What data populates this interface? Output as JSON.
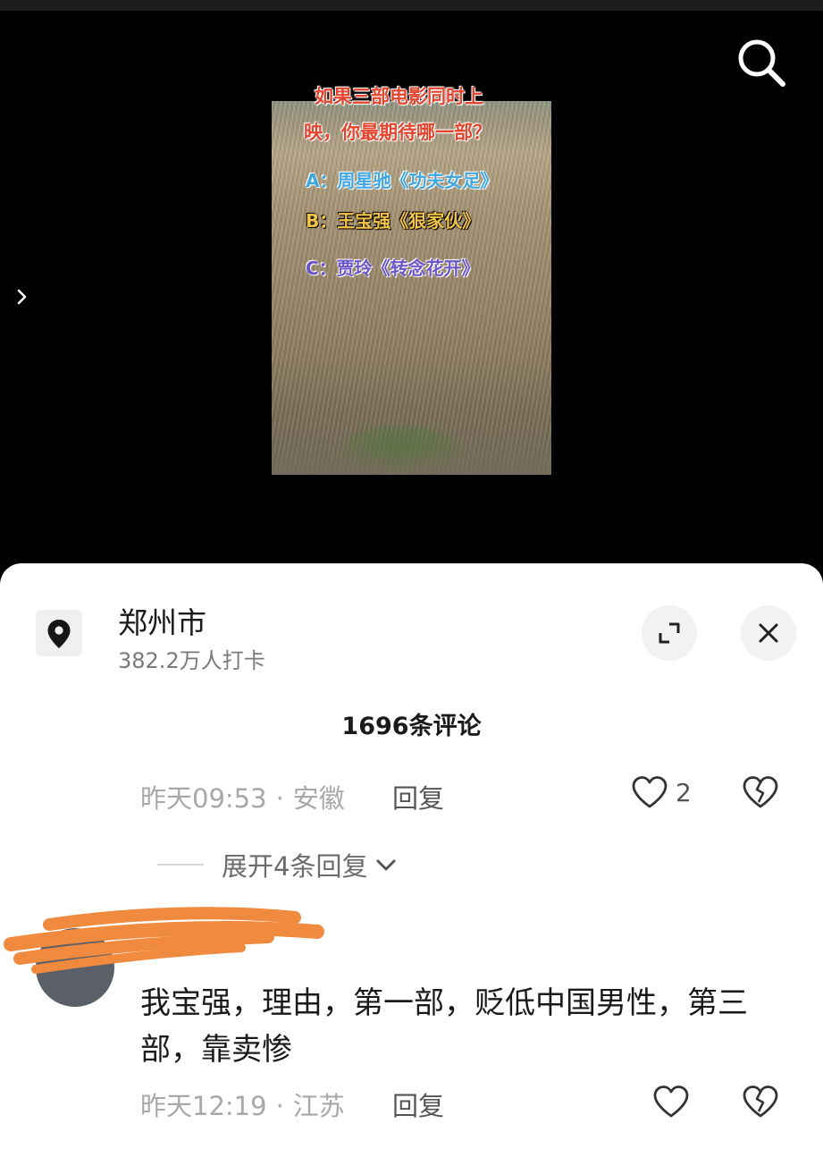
{
  "video": {
    "question_line1": "如果三部电影同时上",
    "question_line2": "映，你最期待哪一部？",
    "option_a": "A：周星驰《功夫女足》",
    "option_b": "B：王宝强《狠家伙》",
    "option_c": "C：贾玲《转念花开》",
    "search_icon": "search-icon",
    "side_arrow_icon": "chevron-right-icon"
  },
  "location": {
    "name": "郑州市",
    "checkins": "382.2万人打卡",
    "pin_icon": "location-pin-icon"
  },
  "panel": {
    "comment_count": "1696条评论",
    "expand_icon": "expand-icon",
    "close_icon": "close-icon"
  },
  "comments": [
    {
      "time": "昨天09:53",
      "dot": "·",
      "region": "安徽",
      "reply_label": "回复",
      "like_count": "2",
      "expand_replies": "展开4条回复"
    },
    {
      "text": "我宝强，理由，第一部，贬低中国男性，第三部，靠卖惨",
      "time": "昨天12:19",
      "dot": "·",
      "region": "江苏",
      "reply_label": "回复",
      "like_count": ""
    }
  ],
  "colors": {
    "question": "#e3452f",
    "option_a": "#3fa6e0",
    "option_b": "#f2c44a",
    "option_c": "#6b55c8",
    "scribble": "#f08a3e"
  }
}
